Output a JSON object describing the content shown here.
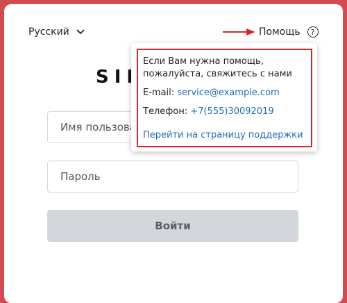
{
  "header": {
    "language": "Русский",
    "help_label": "Помощь",
    "help_icon_glyph": "?"
  },
  "brand": {
    "logo_text": "SIN"
  },
  "form": {
    "username_placeholder": "Имя пользователя",
    "password_placeholder": "Пароль",
    "login_label": "Войти"
  },
  "help_popover": {
    "message_line1": "Если Вам нужна помощь,",
    "message_line2": "пожалуйста, свяжитесь с нами",
    "email_label": "E-mail:",
    "email_value": "service@example.com",
    "phone_label": "Телефон:",
    "phone_value": "+7(555)30092019",
    "support_link": "Перейти на страницу поддержки"
  },
  "colors": {
    "background": "#d34b52",
    "link": "#1c6cb4",
    "highlight": "#e0242a",
    "button_disabled": "#d3d6da"
  }
}
